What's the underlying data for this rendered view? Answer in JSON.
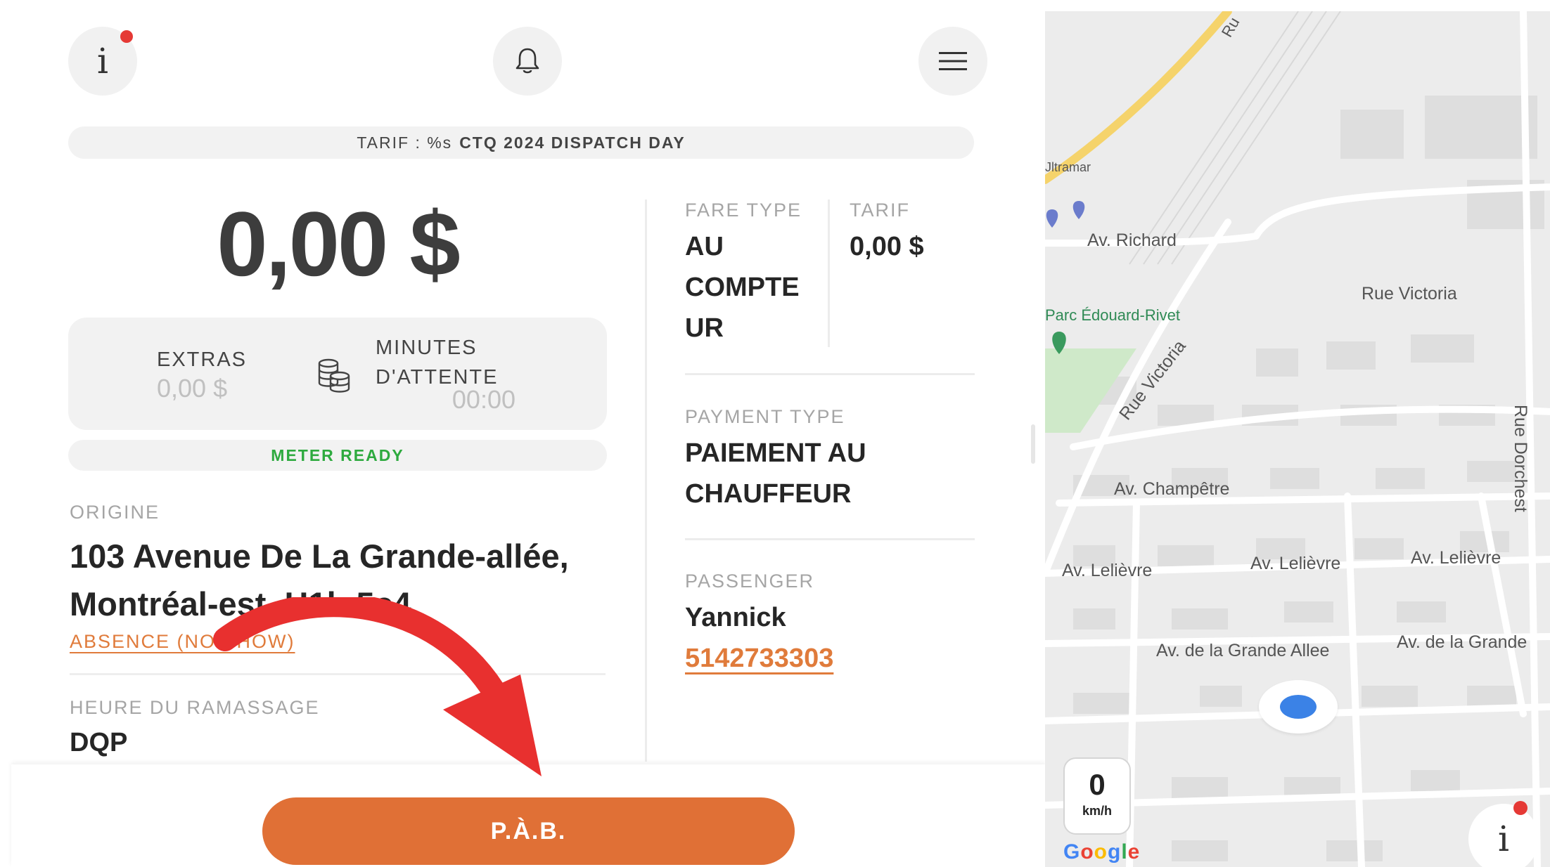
{
  "header": {
    "info_icon": "info-icon",
    "bell_icon": "bell-icon",
    "menu_icon": "hamburger-menu-icon"
  },
  "tarif_bar": {
    "prefix": "TARIF : %s",
    "name": "CTQ 2024 DISPATCH DAY"
  },
  "meter": {
    "amount": "0,00 $",
    "extras_label": "EXTRAS",
    "extras_value": "0,00 $",
    "minutes_label_line1": "MINUTES",
    "minutes_label_line2": "D'ATTENTE",
    "minutes_value": "00:00",
    "status": "METER READY",
    "coins_icon": "coins-stack-icon"
  },
  "origin": {
    "label": "ORIGINE",
    "address_line1": "103 Avenue De La Grande-allée,",
    "address_line2": "Montréal-est, H1b 5c4",
    "absence_link": "ABSENCE (NO SHOW)"
  },
  "pickup": {
    "label": "HEURE DU RAMASSAGE",
    "value": "DQP"
  },
  "fare": {
    "type_label": "FARE TYPE",
    "type_value_lines": [
      "AU",
      "COMPTE",
      "UR"
    ],
    "tarif_label": "TARIF",
    "tarif_value": "0,00 $"
  },
  "payment": {
    "label": "PAYMENT TYPE",
    "value_line1": "PAIEMENT AU",
    "value_line2": "CHAUFFEUR"
  },
  "passenger": {
    "label": "PASSENGER",
    "name": "Yannick",
    "phone": "5142733303"
  },
  "action": {
    "button_label": "P.À.B."
  },
  "map": {
    "streets": {
      "ru": "Ru",
      "ultramar": "Jltramar",
      "av_richard": "Av. Richard",
      "rue_victoria_1": "Rue Victoria",
      "parc": "Parc Édouard-Rivet",
      "rue_victoria_2": "Rue Victoria",
      "rue_dorchester": "Rue Dorchest",
      "av_champetre": "Av. Champêtre",
      "av_lelievre_1": "Av. Lelièvre",
      "av_lelievre_2": "Av. Lelièvre",
      "av_lelievre_3": "Av. Lelièvre",
      "av_grande_allee_1": "Av. de la Grande Allee",
      "av_grande_allee_2": "Av. de la Grande"
    },
    "speed_value": "0",
    "speed_unit": "km/h",
    "google_logo": "Google",
    "colors": {
      "highway": "#f5d36b",
      "park": "#cfe9c9",
      "location": "#3b82e6"
    }
  },
  "colors": {
    "accent": "#e07036",
    "link": "#e07b3b",
    "status_ok": "#2eaa3f",
    "notification": "#e53935"
  }
}
